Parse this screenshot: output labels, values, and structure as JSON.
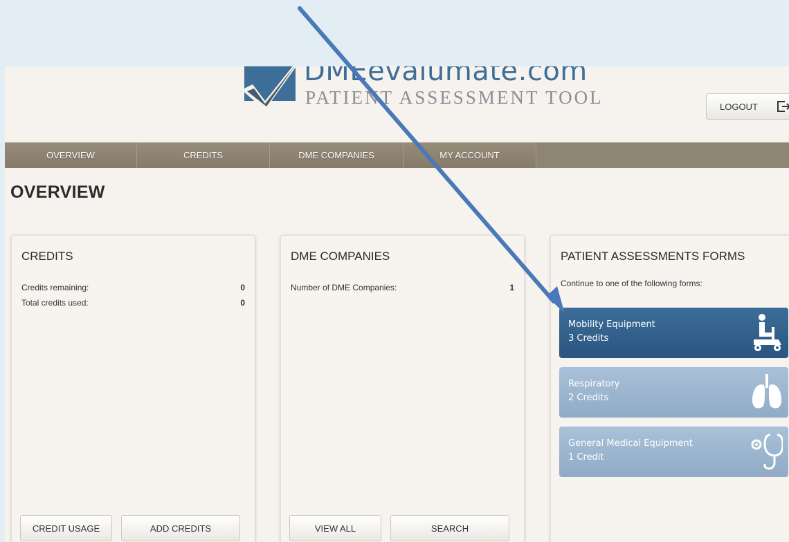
{
  "logo": {
    "wordmark": "DMEevalumate.com",
    "tagline": "PATIENT ASSESSMENT TOOL"
  },
  "header": {
    "logout_label": "LOGOUT"
  },
  "nav": {
    "items": [
      {
        "label": "OVERVIEW"
      },
      {
        "label": "CREDITS"
      },
      {
        "label": "DME COMPANIES"
      },
      {
        "label": "MY ACCOUNT"
      }
    ]
  },
  "page": {
    "title": "OVERVIEW"
  },
  "credits_panel": {
    "title": "CREDITS",
    "rows": [
      {
        "label": "Credits remaining:",
        "value": "0"
      },
      {
        "label": "Total credits used:",
        "value": "0"
      }
    ],
    "buttons": [
      {
        "label": "CREDIT USAGE"
      },
      {
        "label": "ADD CREDITS"
      }
    ]
  },
  "dme_panel": {
    "title": "DME COMPANIES",
    "rows": [
      {
        "label": "Number of DME Companies:",
        "value": "1"
      }
    ],
    "buttons": [
      {
        "label": "VIEW ALL"
      },
      {
        "label": "SEARCH"
      }
    ]
  },
  "forms_panel": {
    "title": "PATIENT ASSESSMENTS FORMS",
    "intro": "Continue to one of the following forms:",
    "forms": [
      {
        "name": "Mobility Equipment",
        "credits": "3 Credits",
        "icon": "mobility-scooter-icon",
        "color": "#2f5f8b",
        "active": true
      },
      {
        "name": "Respiratory",
        "credits": "2 Credits",
        "icon": "lungs-icon",
        "color": "#9db6cf",
        "active": false
      },
      {
        "name": "General Medical Equipment",
        "credits": "1 Credit",
        "icon": "stethoscope-icon",
        "color": "#9db6cf",
        "active": false
      }
    ]
  },
  "colors": {
    "nav": "#8f8573",
    "brand": "#3e6f99",
    "annotation_arrow": "#4a78b8"
  }
}
